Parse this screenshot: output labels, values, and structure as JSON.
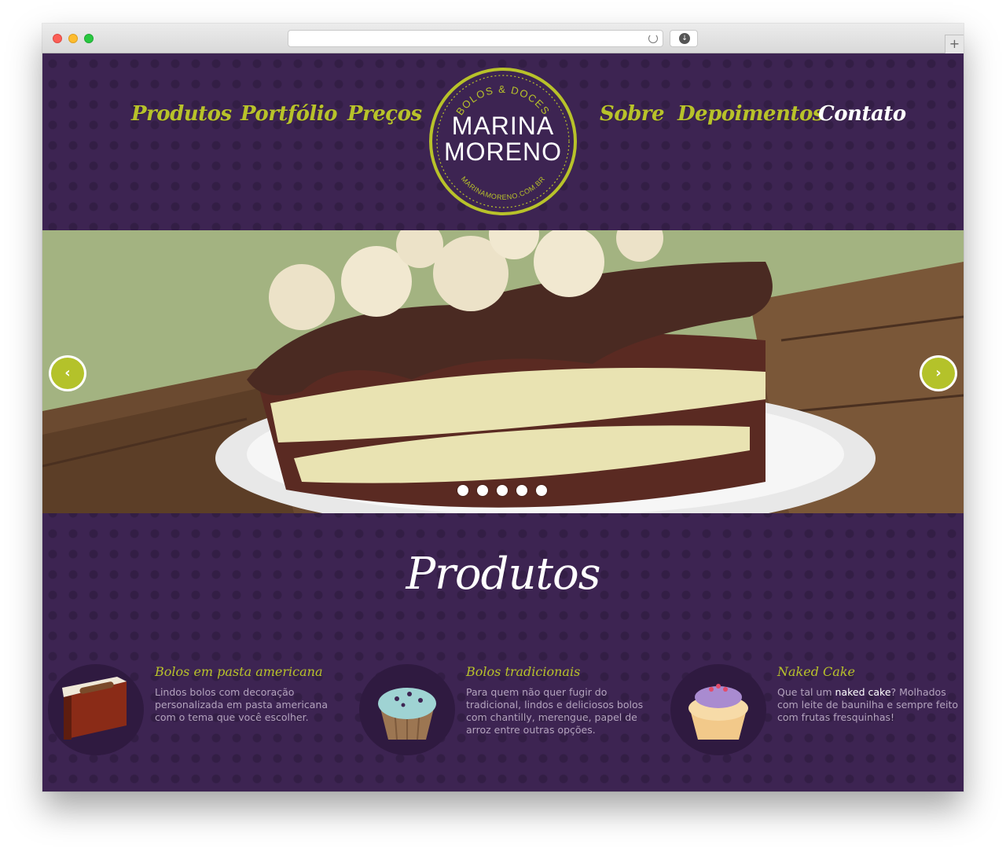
{
  "nav": {
    "left": [
      "Produtos",
      "Portfólio",
      "Preços"
    ],
    "right": [
      "Sobre",
      "Depoimentos",
      "Contato"
    ],
    "active": "Contato"
  },
  "logo": {
    "top_text": "BOLOS & DOCES",
    "line1": "MARINA",
    "line2": "MORENO",
    "bottom_text": "MARINAMORENO.COM.BR"
  },
  "slider": {
    "prev_icon": "chevron-left-icon",
    "next_icon": "chevron-right-icon",
    "prev_glyph": "‹",
    "next_glyph": "›",
    "dot_count": 5
  },
  "products_section": {
    "title": "Produtos",
    "items": [
      {
        "title": "Bolos em pasta americana",
        "description": "Lindos bolos com decoração personalizada em pasta americana com o tema que você escolher.",
        "icon": "cake-slice-icon"
      },
      {
        "title": "Bolos tradicionais",
        "description": "Para quem não quer fugir do tradicional, lindos e deliciosos bolos com chantilly, merengue, papel de arroz entre outras opções.",
        "icon": "cupcake-blue-icon"
      },
      {
        "title": "Naked Cake",
        "description_before": "Que tal um ",
        "description_link": "naked cake",
        "description_after": "? Molhados com leite de baunilha e sempre feito com frutas fresquinhas!",
        "icon": "cupcake-purple-icon"
      }
    ]
  },
  "colors": {
    "background": "#3d2452",
    "accent": "#b8c22a",
    "text_muted": "#b3a3bd",
    "white": "#ffffff"
  }
}
